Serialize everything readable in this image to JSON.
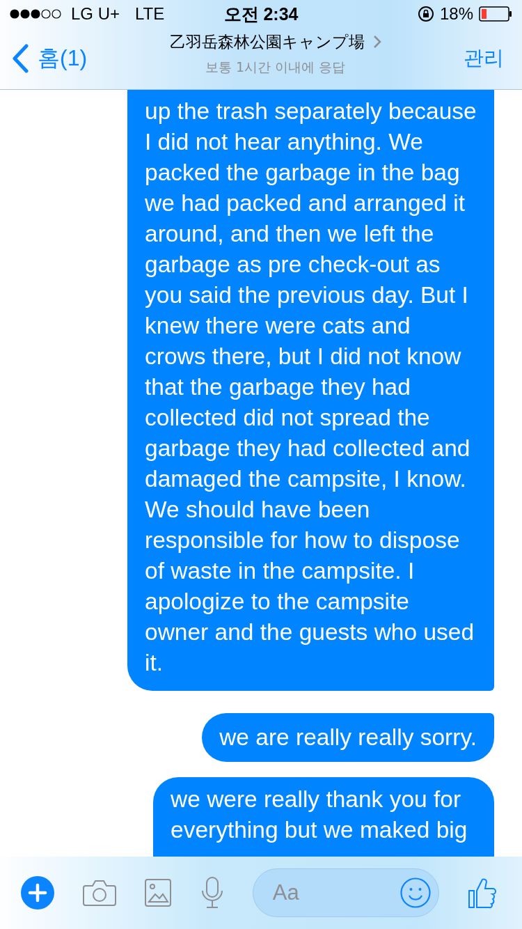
{
  "status_bar": {
    "carrier": "LG U+",
    "network": "LTE",
    "time": "오전 2:34",
    "battery": "18%"
  },
  "header": {
    "back": "홈(1)",
    "title": "乙羽岳森林公園キャンプ場",
    "subtitle": "보통 1시간 이내에 응답",
    "action": "관리"
  },
  "messages": [
    {
      "text": "up the trash separately because I did not hear anything. We packed the garbage in the bag we had packed and arranged it around, and then we left the garbage as pre check-out as you said the previous day. But I knew there were cats and crows there, but I did not know that the garbage they had collected did not spread the garbage they had collected and damaged the campsite, I know. We should have been responsible for how to dispose of waste in the campsite. I apologize to the campsite owner and the guests who used it."
    },
    {
      "text": "we are really really sorry."
    },
    {
      "text": "we were really thank you for everything but we maked big"
    }
  ],
  "composer": {
    "placeholder": "Aa"
  }
}
